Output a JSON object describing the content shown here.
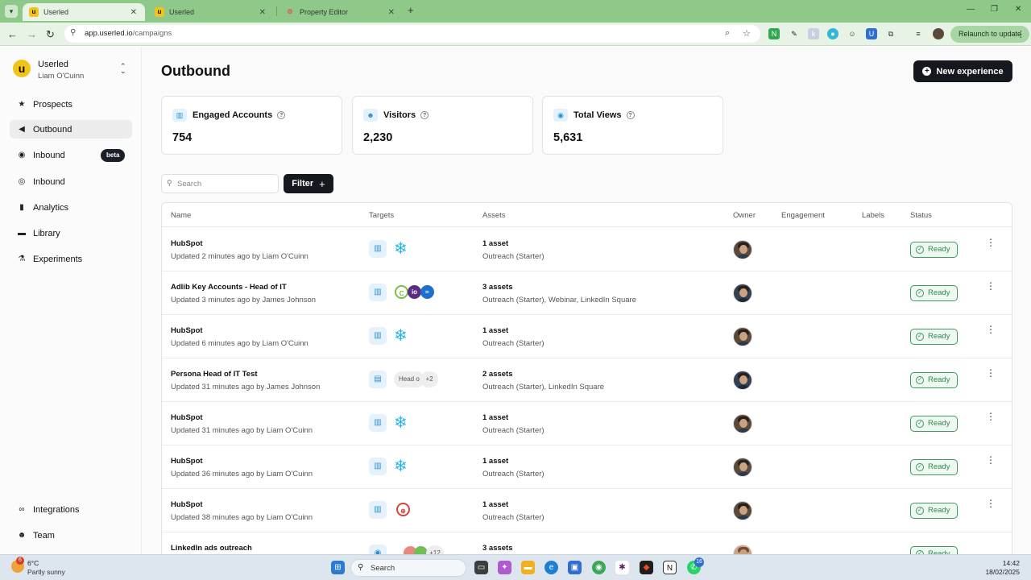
{
  "browser": {
    "tabs": [
      {
        "label": "Userled",
        "icon": "userled-logo",
        "active": true
      },
      {
        "label": "Userled",
        "icon": "userled-logo",
        "active": false
      },
      {
        "label": "Property Editor",
        "icon": "hubspot-icon",
        "active": false
      }
    ],
    "url_host": "app.userled.io",
    "url_path": "/campaigns",
    "relaunch_label": "Relaunch to update"
  },
  "sidebar": {
    "brand_letter": "u",
    "workspace": "Userled",
    "user": "Liam O'Cuinn",
    "nav": [
      {
        "label": "Prospects",
        "icon": "star-icon"
      },
      {
        "label": "Outbound",
        "icon": "megaphone-icon",
        "active": true
      },
      {
        "label": "Inbound",
        "icon": "globe-icon",
        "badge": "beta"
      },
      {
        "label": "Inbound",
        "icon": "binoculars-icon"
      },
      {
        "label": "Analytics",
        "icon": "bar-chart-icon"
      },
      {
        "label": "Library",
        "icon": "book-icon"
      },
      {
        "label": "Experiments",
        "icon": "flask-icon"
      }
    ],
    "bottom_nav": [
      {
        "label": "Integrations",
        "icon": "link-icon"
      },
      {
        "label": "Team",
        "icon": "people-icon"
      }
    ]
  },
  "page": {
    "title": "Outbound",
    "new_button": "New experience",
    "stats": [
      {
        "label": "Engaged Accounts",
        "value": "754",
        "icon": "building-icon"
      },
      {
        "label": "Visitors",
        "value": "2,230",
        "icon": "people-icon"
      },
      {
        "label": "Total Views",
        "value": "5,631",
        "icon": "eye-icon"
      }
    ],
    "search_placeholder": "Search",
    "filter_label": "Filter",
    "columns": [
      "Name",
      "Targets",
      "Assets",
      "Owner",
      "Engagement",
      "Labels",
      "Status"
    ],
    "rows": [
      {
        "name": "HubSpot",
        "updated": "Updated 2 minutes ago by Liam O'Cuinn",
        "assets": "1 asset",
        "asset_list": "Outreach (Starter)",
        "owner": "liam",
        "status": "Ready",
        "targets": "building+snowflake"
      },
      {
        "name": "Adlib Key Accounts - Head of IT",
        "updated": "Updated 3 minutes ago by James Johnson",
        "assets": "3 assets",
        "asset_list": "Outreach (Starter), Webinar, LinkedIn Square",
        "owner": "james",
        "status": "Ready",
        "targets": "building+logos"
      },
      {
        "name": "HubSpot",
        "updated": "Updated 6 minutes ago by Liam O'Cuinn",
        "assets": "1 asset",
        "asset_list": "Outreach (Starter)",
        "owner": "liam",
        "status": "Ready",
        "targets": "building+snowflake"
      },
      {
        "name": "Persona Head of IT Test",
        "updated": "Updated 31 minutes ago by James Johnson",
        "assets": "2 assets",
        "asset_list": "Outreach (Starter), LinkedIn Square",
        "owner": "james",
        "status": "Ready",
        "targets": "persona",
        "chip": "Head o",
        "more": "+2"
      },
      {
        "name": "HubSpot",
        "updated": "Updated 31 minutes ago by Liam O'Cuinn",
        "assets": "1 asset",
        "asset_list": "Outreach (Starter)",
        "owner": "liam",
        "status": "Ready",
        "targets": "building+snowflake"
      },
      {
        "name": "HubSpot",
        "updated": "Updated 36 minutes ago by Liam O'Cuinn",
        "assets": "1 asset",
        "asset_list": "Outreach (Starter)",
        "owner": "liam",
        "status": "Ready",
        "targets": "building+snowflake"
      },
      {
        "name": "HubSpot",
        "updated": "Updated 38 minutes ago by Liam O'Cuinn",
        "assets": "1 asset",
        "asset_list": "Outreach (Starter)",
        "owner": "liam",
        "status": "Ready",
        "targets": "building+target"
      },
      {
        "name": "LinkedIn ads outreach",
        "updated": "",
        "assets": "3 assets",
        "asset_list": "",
        "owner": "other",
        "status": "Ready",
        "targets": "mixed",
        "more": "+12"
      }
    ]
  },
  "taskbar": {
    "temp": "6°C",
    "weather": "Partly sunny",
    "weather_badge": "6",
    "search": "Search",
    "whatsapp_badge": "16",
    "time": "14:42",
    "date": "18/02/2025"
  },
  "colors": {
    "brand_yellow": "#f2c41a",
    "primary_dark": "#15181f",
    "ready_green": "#2f8a52",
    "tabbar_green": "#8fc98a"
  }
}
